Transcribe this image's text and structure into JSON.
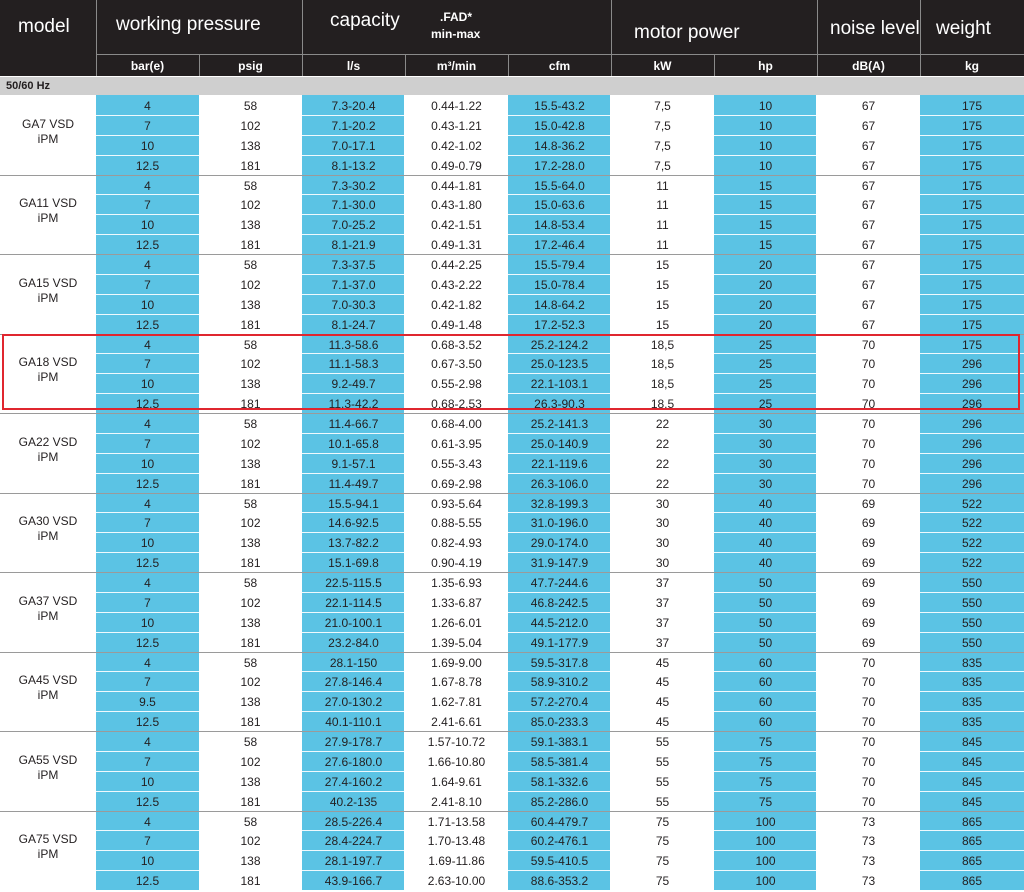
{
  "header": {
    "model": "model",
    "working_pressure": "working pressure",
    "capacity": "capacity",
    "fad": ".FAD*",
    "fad_range": "min-max",
    "motor_power": "motor power",
    "noise_level": "noise level",
    "weight": "weight"
  },
  "units": [
    "bar(e)",
    "psig",
    "l/s",
    "m³/min",
    "cfm",
    "kW",
    "hp",
    "dB(A)",
    "kg"
  ],
  "section_label": "50/60 Hz",
  "colors": {
    "header_bg": "#231f20",
    "accent_blue": "#5bc3e4",
    "section_bg": "#cfcfcf",
    "highlight_border": "#e0262f"
  },
  "groups": [
    {
      "model": "GA7 VSD",
      "sub": "iPM",
      "rows": [
        [
          "4",
          "58",
          "7.3-20.4",
          "0.44-1.22",
          "15.5-43.2",
          "7,5",
          "10",
          "67",
          "175"
        ],
        [
          "7",
          "102",
          "7.1-20.2",
          "0.43-1.21",
          "15.0-42.8",
          "7,5",
          "10",
          "67",
          "175"
        ],
        [
          "10",
          "138",
          "7.0-17.1",
          "0.42-1.02",
          "14.8-36.2",
          "7,5",
          "10",
          "67",
          "175"
        ],
        [
          "12.5",
          "181",
          "8.1-13.2",
          "0.49-0.79",
          "17.2-28.0",
          "7,5",
          "10",
          "67",
          "175"
        ]
      ]
    },
    {
      "model": "GA11 VSD",
      "sub": "iPM",
      "rows": [
        [
          "4",
          "58",
          "7.3-30.2",
          "0.44-1.81",
          "15.5-64.0",
          "11",
          "15",
          "67",
          "175"
        ],
        [
          "7",
          "102",
          "7.1-30.0",
          "0.43-1.80",
          "15.0-63.6",
          "11",
          "15",
          "67",
          "175"
        ],
        [
          "10",
          "138",
          "7.0-25.2",
          "0.42-1.51",
          "14.8-53.4",
          "11",
          "15",
          "67",
          "175"
        ],
        [
          "12.5",
          "181",
          "8.1-21.9",
          "0.49-1.31",
          "17.2-46.4",
          "11",
          "15",
          "67",
          "175"
        ]
      ]
    },
    {
      "model": "GA15 VSD",
      "sub": "iPM",
      "rows": [
        [
          "4",
          "58",
          "7.3-37.5",
          "0.44-2.25",
          "15.5-79.4",
          "15",
          "20",
          "67",
          "175"
        ],
        [
          "7",
          "102",
          "7.1-37.0",
          "0.43-2.22",
          "15.0-78.4",
          "15",
          "20",
          "67",
          "175"
        ],
        [
          "10",
          "138",
          "7.0-30.3",
          "0.42-1.82",
          "14.8-64.2",
          "15",
          "20",
          "67",
          "175"
        ],
        [
          "12.5",
          "181",
          "8.1-24.7",
          "0.49-1.48",
          "17.2-52.3",
          "15",
          "20",
          "67",
          "175"
        ]
      ]
    },
    {
      "model": "GA18 VSD",
      "sub": "iPM",
      "rows": [
        [
          "4",
          "58",
          "11.3-58.6",
          "0.68-3.52",
          "25.2-124.2",
          "18,5",
          "25",
          "70",
          "175"
        ],
        [
          "7",
          "102",
          "11.1-58.3",
          "0.67-3.50",
          "25.0-123.5",
          "18,5",
          "25",
          "70",
          "296"
        ],
        [
          "10",
          "138",
          "9.2-49.7",
          "0.55-2.98",
          "22.1-103.1",
          "18,5",
          "25",
          "70",
          "296"
        ],
        [
          "12.5",
          "181",
          "11.3-42.2",
          "0.68-2.53",
          "26.3-90.3",
          "18,5",
          "25",
          "70",
          "296"
        ]
      ]
    },
    {
      "model": "GA22 VSD",
      "sub": "iPM",
      "rows": [
        [
          "4",
          "58",
          "11.4-66.7",
          "0.68-4.00",
          "25.2-141.3",
          "22",
          "30",
          "70",
          "296"
        ],
        [
          "7",
          "102",
          "10.1-65.8",
          "0.61-3.95",
          "25.0-140.9",
          "22",
          "30",
          "70",
          "296"
        ],
        [
          "10",
          "138",
          "9.1-57.1",
          "0.55-3.43",
          "22.1-119.6",
          "22",
          "30",
          "70",
          "296"
        ],
        [
          "12.5",
          "181",
          "11.4-49.7",
          "0.69-2.98",
          "26.3-106.0",
          "22",
          "30",
          "70",
          "296"
        ]
      ]
    },
    {
      "model": "GA30 VSD",
      "sub": "iPM",
      "rows": [
        [
          "4",
          "58",
          "15.5-94.1",
          "0.93-5.64",
          "32.8-199.3",
          "30",
          "40",
          "69",
          "522"
        ],
        [
          "7",
          "102",
          "14.6-92.5",
          "0.88-5.55",
          "31.0-196.0",
          "30",
          "40",
          "69",
          "522"
        ],
        [
          "10",
          "138",
          "13.7-82.2",
          "0.82-4.93",
          "29.0-174.0",
          "30",
          "40",
          "69",
          "522"
        ],
        [
          "12.5",
          "181",
          "15.1-69.8",
          "0.90-4.19",
          "31.9-147.9",
          "30",
          "40",
          "69",
          "522"
        ]
      ]
    },
    {
      "model": "GA37 VSD",
      "sub": "iPM",
      "rows": [
        [
          "4",
          "58",
          "22.5-115.5",
          "1.35-6.93",
          "47.7-244.6",
          "37",
          "50",
          "69",
          "550"
        ],
        [
          "7",
          "102",
          "22.1-114.5",
          "1.33-6.87",
          "46.8-242.5",
          "37",
          "50",
          "69",
          "550"
        ],
        [
          "10",
          "138",
          "21.0-100.1",
          "1.26-6.01",
          "44.5-212.0",
          "37",
          "50",
          "69",
          "550"
        ],
        [
          "12.5",
          "181",
          "23.2-84.0",
          "1.39-5.04",
          "49.1-177.9",
          "37",
          "50",
          "69",
          "550"
        ]
      ]
    },
    {
      "model": "GA45 VSD",
      "sub": "iPM",
      "rows": [
        [
          "4",
          "58",
          "28.1-150",
          "1.69-9.00",
          "59.5-317.8",
          "45",
          "60",
          "70",
          "835"
        ],
        [
          "7",
          "102",
          "27.8-146.4",
          "1.67-8.78",
          "58.9-310.2",
          "45",
          "60",
          "70",
          "835"
        ],
        [
          "9.5",
          "138",
          "27.0-130.2",
          "1.62-7.81",
          "57.2-270.4",
          "45",
          "60",
          "70",
          "835"
        ],
        [
          "12.5",
          "181",
          "40.1-110.1",
          "2.41-6.61",
          "85.0-233.3",
          "45",
          "60",
          "70",
          "835"
        ]
      ]
    },
    {
      "model": "GA55 VSD",
      "sub": "iPM",
      "rows": [
        [
          "4",
          "58",
          "27.9-178.7",
          "1.57-10.72",
          "59.1-383.1",
          "55",
          "75",
          "70",
          "845"
        ],
        [
          "7",
          "102",
          "27.6-180.0",
          "1.66-10.80",
          "58.5-381.4",
          "55",
          "75",
          "70",
          "845"
        ],
        [
          "10",
          "138",
          "27.4-160.2",
          "1.64-9.61",
          "58.1-332.6",
          "55",
          "75",
          "70",
          "845"
        ],
        [
          "12.5",
          "181",
          "40.2-135",
          "2.41-8.10",
          "85.2-286.0",
          "55",
          "75",
          "70",
          "845"
        ]
      ]
    },
    {
      "model": "GA75 VSD",
      "sub": "iPM",
      "rows": [
        [
          "4",
          "58",
          "28.5-226.4",
          "1.71-13.58",
          "60.4-479.7",
          "75",
          "100",
          "73",
          "865"
        ],
        [
          "7",
          "102",
          "28.4-224.7",
          "1.70-13.48",
          "60.2-476.1",
          "75",
          "100",
          "73",
          "865"
        ],
        [
          "10",
          "138",
          "28.1-197.7",
          "1.69-11.86",
          "59.5-410.5",
          "75",
          "100",
          "73",
          "865"
        ],
        [
          "12.5",
          "181",
          "43.9-166.7",
          "2.63-10.00",
          "88.6-353.2",
          "75",
          "100",
          "73",
          "865"
        ]
      ]
    }
  ]
}
